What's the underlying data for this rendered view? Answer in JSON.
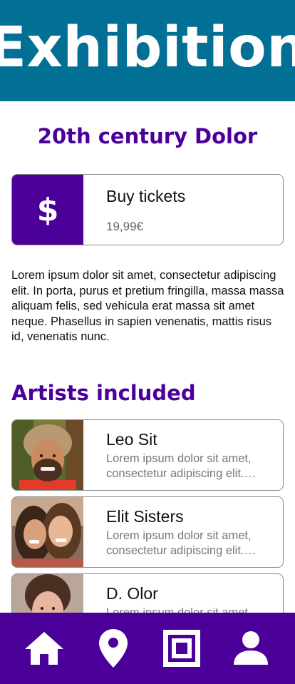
{
  "header": {
    "title": "Exhibition"
  },
  "exhibit": {
    "title": "20th century Dolor"
  },
  "ticket": {
    "icon": "dollar-icon",
    "symbol": "$",
    "label": "Buy tickets",
    "price": "19,99€"
  },
  "description": "Lorem ipsum dolor sit amet, consectetur adipiscing elit. In porta, purus et pretium fringilla, massa massa aliquam felis, sed vehicula erat massa sit amet neque. Phasellus in sapien venenatis, mattis risus id, venenatis nunc.",
  "artists_section": {
    "heading": "Artists included",
    "artists": [
      {
        "name": "Leo Sit",
        "description": "Lorem ipsum dolor sit amet, consectetur adipiscing elit. Phasellus in sapien venenatis."
      },
      {
        "name": "Elit Sisters",
        "description": "Lorem ipsum dolor sit amet, consectetur adipiscing elit. Phasellus in sapien venenatis."
      },
      {
        "name": "D. Olor",
        "description": "Lorem ipsum dolor sit amet, consectetur adipiscing elit. Phasellus in sapien venenatis."
      }
    ]
  },
  "nav": {
    "items": [
      {
        "icon": "home-icon"
      },
      {
        "icon": "location-pin-icon"
      },
      {
        "icon": "frame-icon"
      },
      {
        "icon": "person-icon"
      }
    ]
  },
  "colors": {
    "header_bg": "#026f95",
    "accent": "#4b0099",
    "nav_bg": "#4b0099"
  }
}
